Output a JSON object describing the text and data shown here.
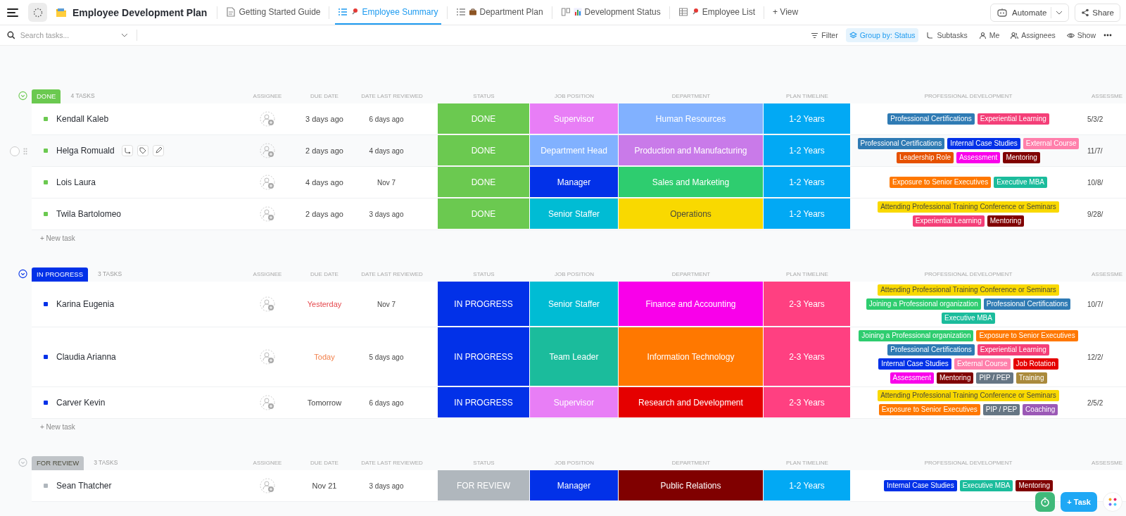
{
  "topbar": {
    "title": "Employee Development Plan",
    "tabs": [
      {
        "label": "Getting Started Guide",
        "selected": false
      },
      {
        "label": "Employee Summary",
        "selected": true
      },
      {
        "label": "Department Plan",
        "selected": false
      },
      {
        "label": "Development Status",
        "selected": false
      },
      {
        "label": "Employee List",
        "selected": false
      }
    ],
    "add_view": "+ View",
    "automate": "Automate",
    "share": "Share"
  },
  "toolbar": {
    "search": {
      "placeholder": "Search tasks..."
    },
    "actions": [
      {
        "label": "Filter",
        "selected": false
      },
      {
        "label": "Group by: Status",
        "selected": true
      },
      {
        "label": "Subtasks",
        "selected": false
      },
      {
        "label": "Me",
        "selected": false
      },
      {
        "label": "Assignees",
        "selected": false
      },
      {
        "label": "Show",
        "selected": false
      }
    ]
  },
  "groups": [
    {
      "label": "DONE",
      "count": "4 TASKS",
      "color": "#6bc950",
      "expanded": true,
      "columns": [
        "ASSIGNEE",
        "DUE DATE",
        "DATE LAST REVIEWED",
        "STATUS",
        "JOB POSITION",
        "DEPARTMENT",
        "PLAN TIMELINE",
        "PROFESSIONAL DEVELOPMENT",
        "ASSESSME"
      ],
      "rows": [
        {
          "name": "Kendall Kaleb",
          "hovered": false,
          "checked": false,
          "due": {
            "text": "3 days ago",
            "color": "#444444"
          },
          "reviewed": "6 days ago",
          "status": {
            "label": "DONE",
            "color": "#6bc950"
          },
          "job": {
            "label": "Supervisor",
            "color": "#e87ef6"
          },
          "department": {
            "label": "Human Resources",
            "color": "#81b1ff"
          },
          "plan": {
            "label": "1-2 Years",
            "color": "#02a9f4"
          },
          "development": [
            {
              "label": "Professional Certifications",
              "color": "#2f7bb4"
            },
            {
              "label": "Experiential Learning",
              "color": "#f43f78"
            }
          ],
          "assessment": "5/3/2"
        },
        {
          "name": "Helga Romuald",
          "hovered": true,
          "checked": false,
          "due": {
            "text": "2 days ago",
            "color": "#444444"
          },
          "reviewed": "4 days ago",
          "status": {
            "label": "DONE",
            "color": "#6bc950"
          },
          "job": {
            "label": "Department Head",
            "color": "#81b1ff"
          },
          "department": {
            "label": "Production and Manufacturing",
            "color": "#c97ae9"
          },
          "plan": {
            "label": "1-2 Years",
            "color": "#02a9f4"
          },
          "development": [
            {
              "label": "Professional Certifications",
              "color": "#2f7bb4"
            },
            {
              "label": "Internal Case Studies",
              "color": "#0231e8"
            },
            {
              "label": "External Course",
              "color": "#ff7fab"
            },
            {
              "label": "Leadership Role",
              "color": "#e65100"
            },
            {
              "label": "Assessment",
              "color": "#f900ea"
            },
            {
              "label": "Mentoring",
              "color": "#800000"
            }
          ],
          "assessment": "11/7/"
        },
        {
          "name": "Lois Laura",
          "hovered": false,
          "checked": false,
          "due": {
            "text": "4 days ago",
            "color": "#444444"
          },
          "reviewed": "Nov 7",
          "status": {
            "label": "DONE",
            "color": "#6bc950"
          },
          "job": {
            "label": "Manager",
            "color": "#0231e8"
          },
          "department": {
            "label": "Sales and Marketing",
            "color": "#2ecd6f"
          },
          "plan": {
            "label": "1-2 Years",
            "color": "#02a9f4"
          },
          "development": [
            {
              "label": "Exposure to Senior Executives",
              "color": "#ff7800"
            },
            {
              "label": "Executive MBA",
              "color": "#1bbc9c"
            }
          ],
          "assessment": "10/8/"
        },
        {
          "name": "Twila Bartolomeo",
          "hovered": false,
          "checked": false,
          "due": {
            "text": "2 days ago",
            "color": "#444444"
          },
          "reviewed": "3 days ago",
          "status": {
            "label": "DONE",
            "color": "#6bc950"
          },
          "job": {
            "label": "Senior Staffer",
            "color": "#00bcd4"
          },
          "department": {
            "label": "Operations",
            "color": "#f9d900"
          },
          "plan": {
            "label": "1-2 Years",
            "color": "#02a9f4"
          },
          "development": [
            {
              "label": "Attending Professional Training Conference or Seminars",
              "color": "#f9d900"
            },
            {
              "label": "Experiential Learning",
              "color": "#f43f78"
            },
            {
              "label": "Mentoring",
              "color": "#800000"
            }
          ],
          "assessment": "9/28/"
        }
      ],
      "new_task": "+ New task"
    },
    {
      "label": "IN PROGRESS",
      "count": "3 TASKS",
      "color": "#0231e8",
      "expanded": true,
      "columns": [
        "ASSIGNEE",
        "DUE DATE",
        "DATE LAST REVIEWED",
        "STATUS",
        "JOB POSITION",
        "DEPARTMENT",
        "PLAN TIMELINE",
        "PROFESSIONAL DEVELOPMENT",
        "ASSESSME"
      ],
      "rows": [
        {
          "name": "Karina Eugenia",
          "hovered": false,
          "checked": false,
          "due": {
            "text": "Yesterday",
            "color": "#e5484d"
          },
          "reviewed": "Nov 7",
          "status": {
            "label": "IN PROGRESS",
            "color": "#0231e8"
          },
          "job": {
            "label": "Senior Staffer",
            "color": "#00bcd4"
          },
          "department": {
            "label": "Finance and Accounting",
            "color": "#f900ea"
          },
          "plan": {
            "label": "2-3 Years",
            "color": "#ff4081"
          },
          "development": [
            {
              "label": "Attending Professional Training Conference or Seminars",
              "color": "#f9d900"
            },
            {
              "label": "Joining a Professional organization",
              "color": "#2ecd6f"
            },
            {
              "label": "Professional Certifications",
              "color": "#2f7bb4"
            },
            {
              "label": "Executive MBA",
              "color": "#1bbc9c"
            }
          ],
          "assessment": "10/7/"
        },
        {
          "name": "Claudia Arianna",
          "hovered": false,
          "checked": false,
          "due": {
            "text": "Today",
            "color": "#f2804b"
          },
          "reviewed": "5 days ago",
          "status": {
            "label": "IN PROGRESS",
            "color": "#0231e8"
          },
          "job": {
            "label": "Team Leader",
            "color": "#1bbc9c"
          },
          "department": {
            "label": "Information Technology",
            "color": "#ff7800"
          },
          "plan": {
            "label": "2-3 Years",
            "color": "#ff4081"
          },
          "development": [
            {
              "label": "Joining a Professional organization",
              "color": "#2ecd6f"
            },
            {
              "label": "Exposure to Senior Executives",
              "color": "#ff7800"
            },
            {
              "label": "Professional Certifications",
              "color": "#2f7bb4"
            },
            {
              "label": "Experiential Learning",
              "color": "#f43f78"
            },
            {
              "label": "Internal Case Studies",
              "color": "#0231e8"
            },
            {
              "label": "External Course",
              "color": "#ff7fab"
            },
            {
              "label": "Job Rotation",
              "color": "#e50000"
            },
            {
              "label": "Assessment",
              "color": "#f900ea"
            },
            {
              "label": "Mentoring",
              "color": "#800000"
            },
            {
              "label": "PIP / PEP",
              "color": "#667684"
            },
            {
              "label": "Training",
              "color": "#aa8a3c"
            }
          ],
          "assessment": "12/2/"
        },
        {
          "name": "Carver Kevin",
          "hovered": false,
          "checked": false,
          "due": {
            "text": "Tomorrow",
            "color": "#444444"
          },
          "reviewed": "6 days ago",
          "status": {
            "label": "IN PROGRESS",
            "color": "#0231e8"
          },
          "job": {
            "label": "Supervisor",
            "color": "#e87ef6"
          },
          "department": {
            "label": "Research and Development",
            "color": "#e50000"
          },
          "plan": {
            "label": "2-3 Years",
            "color": "#ff4081"
          },
          "development": [
            {
              "label": "Attending Professional Training Conference or Seminars",
              "color": "#f9d900"
            },
            {
              "label": "Exposure to Senior Executives",
              "color": "#ff7800"
            },
            {
              "label": "PIP / PEP",
              "color": "#667684"
            },
            {
              "label": "Coaching",
              "color": "#9b59b6"
            }
          ],
          "assessment": "2/5/2"
        }
      ],
      "new_task": "+ New task"
    },
    {
      "label": "FOR REVIEW",
      "count": "3 TASKS",
      "color": "#c0c4c8",
      "expanded": true,
      "columns": [
        "ASSIGNEE",
        "DUE DATE",
        "DATE LAST REVIEWED",
        "STATUS",
        "JOB POSITION",
        "DEPARTMENT",
        "PLAN TIMELINE",
        "PROFESSIONAL DEVELOPMENT",
        "ASSESSME"
      ],
      "rows": [
        {
          "name": "Sean Thatcher",
          "hovered": false,
          "checked": false,
          "due": {
            "text": "Nov 21",
            "color": "#444444"
          },
          "reviewed": "3 days ago",
          "status": {
            "label": "FOR REVIEW",
            "color": "#b0b7bd"
          },
          "job": {
            "label": "Manager",
            "color": "#0231e8"
          },
          "department": {
            "label": "Public Relations",
            "color": "#800000"
          },
          "plan": {
            "label": "1-2 Years",
            "color": "#02a9f4"
          },
          "development": [
            {
              "label": "Internal Case Studies",
              "color": "#0231e8"
            },
            {
              "label": "Executive MBA",
              "color": "#1bbc9c"
            },
            {
              "label": "Mentoring",
              "color": "#800000"
            }
          ]
        }
      ]
    }
  ],
  "fab": {
    "task": "+ Task"
  }
}
